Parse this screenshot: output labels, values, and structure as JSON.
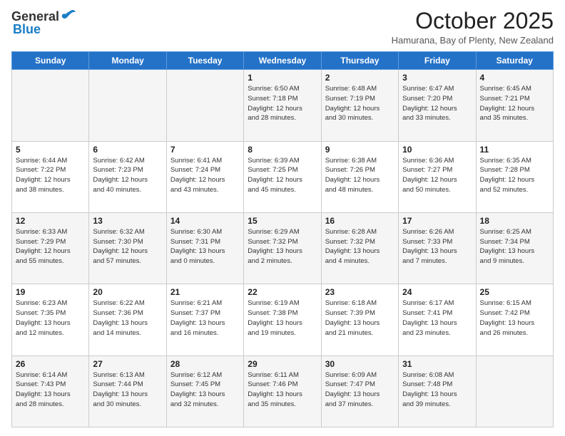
{
  "header": {
    "logo_general": "General",
    "logo_blue": "Blue",
    "month_title": "October 2025",
    "location": "Hamurana, Bay of Plenty, New Zealand"
  },
  "days_of_week": [
    "Sunday",
    "Monday",
    "Tuesday",
    "Wednesday",
    "Thursday",
    "Friday",
    "Saturday"
  ],
  "weeks": [
    [
      {
        "day": "",
        "info": ""
      },
      {
        "day": "",
        "info": ""
      },
      {
        "day": "",
        "info": ""
      },
      {
        "day": "1",
        "info": "Sunrise: 6:50 AM\nSunset: 7:18 PM\nDaylight: 12 hours\nand 28 minutes."
      },
      {
        "day": "2",
        "info": "Sunrise: 6:48 AM\nSunset: 7:19 PM\nDaylight: 12 hours\nand 30 minutes."
      },
      {
        "day": "3",
        "info": "Sunrise: 6:47 AM\nSunset: 7:20 PM\nDaylight: 12 hours\nand 33 minutes."
      },
      {
        "day": "4",
        "info": "Sunrise: 6:45 AM\nSunset: 7:21 PM\nDaylight: 12 hours\nand 35 minutes."
      }
    ],
    [
      {
        "day": "5",
        "info": "Sunrise: 6:44 AM\nSunset: 7:22 PM\nDaylight: 12 hours\nand 38 minutes."
      },
      {
        "day": "6",
        "info": "Sunrise: 6:42 AM\nSunset: 7:23 PM\nDaylight: 12 hours\nand 40 minutes."
      },
      {
        "day": "7",
        "info": "Sunrise: 6:41 AM\nSunset: 7:24 PM\nDaylight: 12 hours\nand 43 minutes."
      },
      {
        "day": "8",
        "info": "Sunrise: 6:39 AM\nSunset: 7:25 PM\nDaylight: 12 hours\nand 45 minutes."
      },
      {
        "day": "9",
        "info": "Sunrise: 6:38 AM\nSunset: 7:26 PM\nDaylight: 12 hours\nand 48 minutes."
      },
      {
        "day": "10",
        "info": "Sunrise: 6:36 AM\nSunset: 7:27 PM\nDaylight: 12 hours\nand 50 minutes."
      },
      {
        "day": "11",
        "info": "Sunrise: 6:35 AM\nSunset: 7:28 PM\nDaylight: 12 hours\nand 52 minutes."
      }
    ],
    [
      {
        "day": "12",
        "info": "Sunrise: 6:33 AM\nSunset: 7:29 PM\nDaylight: 12 hours\nand 55 minutes."
      },
      {
        "day": "13",
        "info": "Sunrise: 6:32 AM\nSunset: 7:30 PM\nDaylight: 12 hours\nand 57 minutes."
      },
      {
        "day": "14",
        "info": "Sunrise: 6:30 AM\nSunset: 7:31 PM\nDaylight: 13 hours\nand 0 minutes."
      },
      {
        "day": "15",
        "info": "Sunrise: 6:29 AM\nSunset: 7:32 PM\nDaylight: 13 hours\nand 2 minutes."
      },
      {
        "day": "16",
        "info": "Sunrise: 6:28 AM\nSunset: 7:32 PM\nDaylight: 13 hours\nand 4 minutes."
      },
      {
        "day": "17",
        "info": "Sunrise: 6:26 AM\nSunset: 7:33 PM\nDaylight: 13 hours\nand 7 minutes."
      },
      {
        "day": "18",
        "info": "Sunrise: 6:25 AM\nSunset: 7:34 PM\nDaylight: 13 hours\nand 9 minutes."
      }
    ],
    [
      {
        "day": "19",
        "info": "Sunrise: 6:23 AM\nSunset: 7:35 PM\nDaylight: 13 hours\nand 12 minutes."
      },
      {
        "day": "20",
        "info": "Sunrise: 6:22 AM\nSunset: 7:36 PM\nDaylight: 13 hours\nand 14 minutes."
      },
      {
        "day": "21",
        "info": "Sunrise: 6:21 AM\nSunset: 7:37 PM\nDaylight: 13 hours\nand 16 minutes."
      },
      {
        "day": "22",
        "info": "Sunrise: 6:19 AM\nSunset: 7:38 PM\nDaylight: 13 hours\nand 19 minutes."
      },
      {
        "day": "23",
        "info": "Sunrise: 6:18 AM\nSunset: 7:39 PM\nDaylight: 13 hours\nand 21 minutes."
      },
      {
        "day": "24",
        "info": "Sunrise: 6:17 AM\nSunset: 7:41 PM\nDaylight: 13 hours\nand 23 minutes."
      },
      {
        "day": "25",
        "info": "Sunrise: 6:15 AM\nSunset: 7:42 PM\nDaylight: 13 hours\nand 26 minutes."
      }
    ],
    [
      {
        "day": "26",
        "info": "Sunrise: 6:14 AM\nSunset: 7:43 PM\nDaylight: 13 hours\nand 28 minutes."
      },
      {
        "day": "27",
        "info": "Sunrise: 6:13 AM\nSunset: 7:44 PM\nDaylight: 13 hours\nand 30 minutes."
      },
      {
        "day": "28",
        "info": "Sunrise: 6:12 AM\nSunset: 7:45 PM\nDaylight: 13 hours\nand 32 minutes."
      },
      {
        "day": "29",
        "info": "Sunrise: 6:11 AM\nSunset: 7:46 PM\nDaylight: 13 hours\nand 35 minutes."
      },
      {
        "day": "30",
        "info": "Sunrise: 6:09 AM\nSunset: 7:47 PM\nDaylight: 13 hours\nand 37 minutes."
      },
      {
        "day": "31",
        "info": "Sunrise: 6:08 AM\nSunset: 7:48 PM\nDaylight: 13 hours\nand 39 minutes."
      },
      {
        "day": "",
        "info": ""
      }
    ]
  ]
}
